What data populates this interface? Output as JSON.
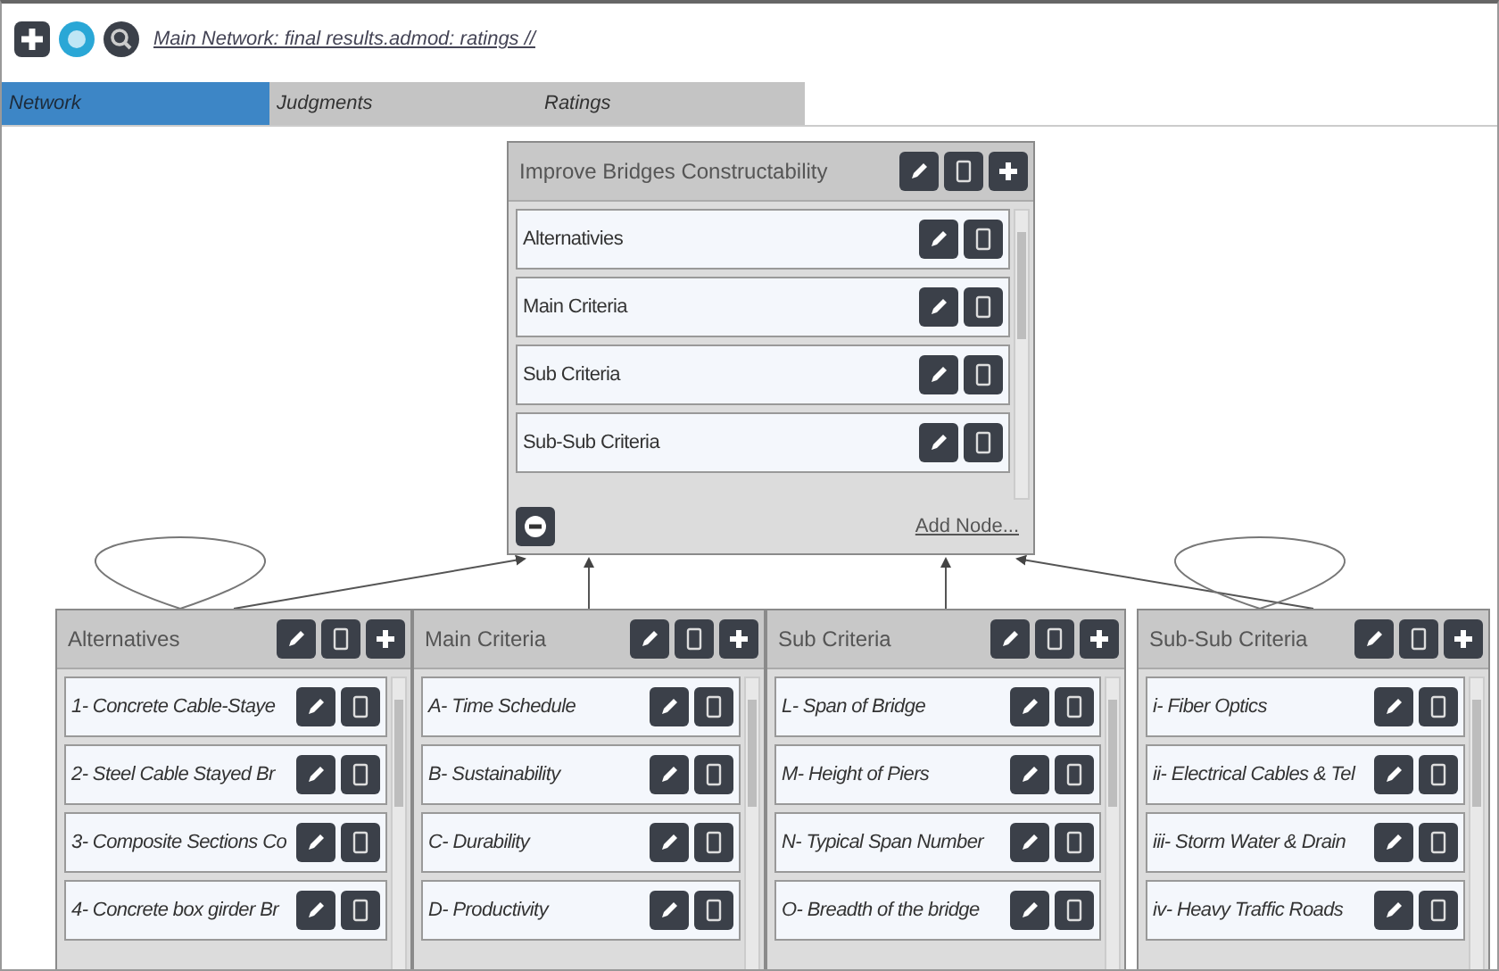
{
  "toolbar": {
    "path_link": "Main Network: final results.admod: ratings //"
  },
  "tabs": [
    {
      "label": "Network",
      "selected": true
    },
    {
      "label": "Judgments",
      "selected": false
    },
    {
      "label": "Ratings",
      "selected": false
    }
  ],
  "clusters": [
    {
      "title": "Improve Bridges Constructability",
      "self_loop": false,
      "nodes": [
        {
          "name": "Alternativies"
        },
        {
          "name": "Main Criteria"
        },
        {
          "name": "Sub Criteria"
        },
        {
          "name": "Sub-Sub Criteria"
        }
      ],
      "footer": {
        "add_node_link": "Add Node..."
      }
    },
    {
      "title": "Alternatives",
      "self_loop": true,
      "nodes": [
        {
          "name": "1- Concrete Cable-Staye"
        },
        {
          "name": "2- Steel Cable Stayed Br"
        },
        {
          "name": "3- Composite Sections Co"
        },
        {
          "name": "4- Concrete box girder Br"
        }
      ]
    },
    {
      "title": "Main Criteria",
      "self_loop": false,
      "nodes": [
        {
          "name": "A- Time Schedule"
        },
        {
          "name": "B- Sustainability"
        },
        {
          "name": "C- Durability"
        },
        {
          "name": "D- Productivity"
        }
      ]
    },
    {
      "title": "Sub Criteria",
      "self_loop": false,
      "nodes": [
        {
          "name": "L- Span of Bridge"
        },
        {
          "name": "M- Height of Piers"
        },
        {
          "name": "N- Typical Span Number"
        },
        {
          "name": "O- Breadth of the bridge"
        }
      ]
    },
    {
      "title": "Sub-Sub Criteria",
      "self_loop": true,
      "nodes": [
        {
          "name": "i- Fiber Optics"
        },
        {
          "name": "ii- Electrical Cables & Tel"
        },
        {
          "name": "iii- Storm Water & Drain"
        },
        {
          "name": "iv- Heavy Traffic Roads"
        }
      ]
    }
  ]
}
